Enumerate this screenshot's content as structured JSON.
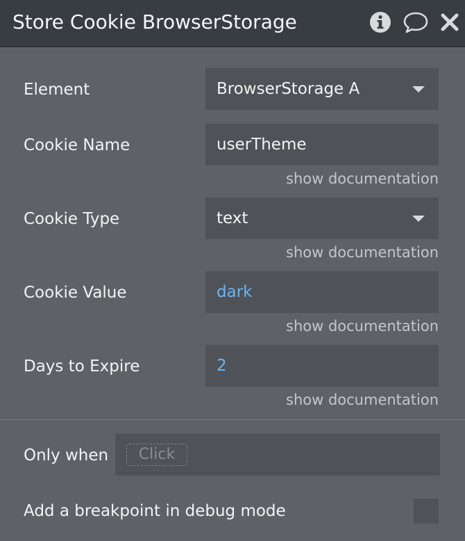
{
  "header": {
    "title": "Store Cookie BrowserStorage A (",
    "icons": [
      "info-icon",
      "comment-icon",
      "close-icon"
    ]
  },
  "fields": {
    "element": {
      "label": "Element",
      "value": "BrowserStorage A"
    },
    "cookie_name": {
      "label": "Cookie Name",
      "value": "userTheme",
      "doc": "show documentation"
    },
    "cookie_type": {
      "label": "Cookie Type",
      "value": "text",
      "doc": "show documentation"
    },
    "cookie_value": {
      "label": "Cookie Value",
      "value": "dark",
      "doc": "show documentation"
    },
    "days_to_expire": {
      "label": "Days to Expire",
      "value": "2",
      "doc": "show documentation"
    }
  },
  "condition": {
    "label": "Only when",
    "placeholder": "Click"
  },
  "breakpoint": {
    "label": "Add a breakpoint in debug mode",
    "checked": false
  },
  "colors": {
    "panel_bg": "#5e6266",
    "header_bg": "#383d42",
    "field_bg": "#4f5357",
    "dynamic_text": "#6cb4f5"
  }
}
